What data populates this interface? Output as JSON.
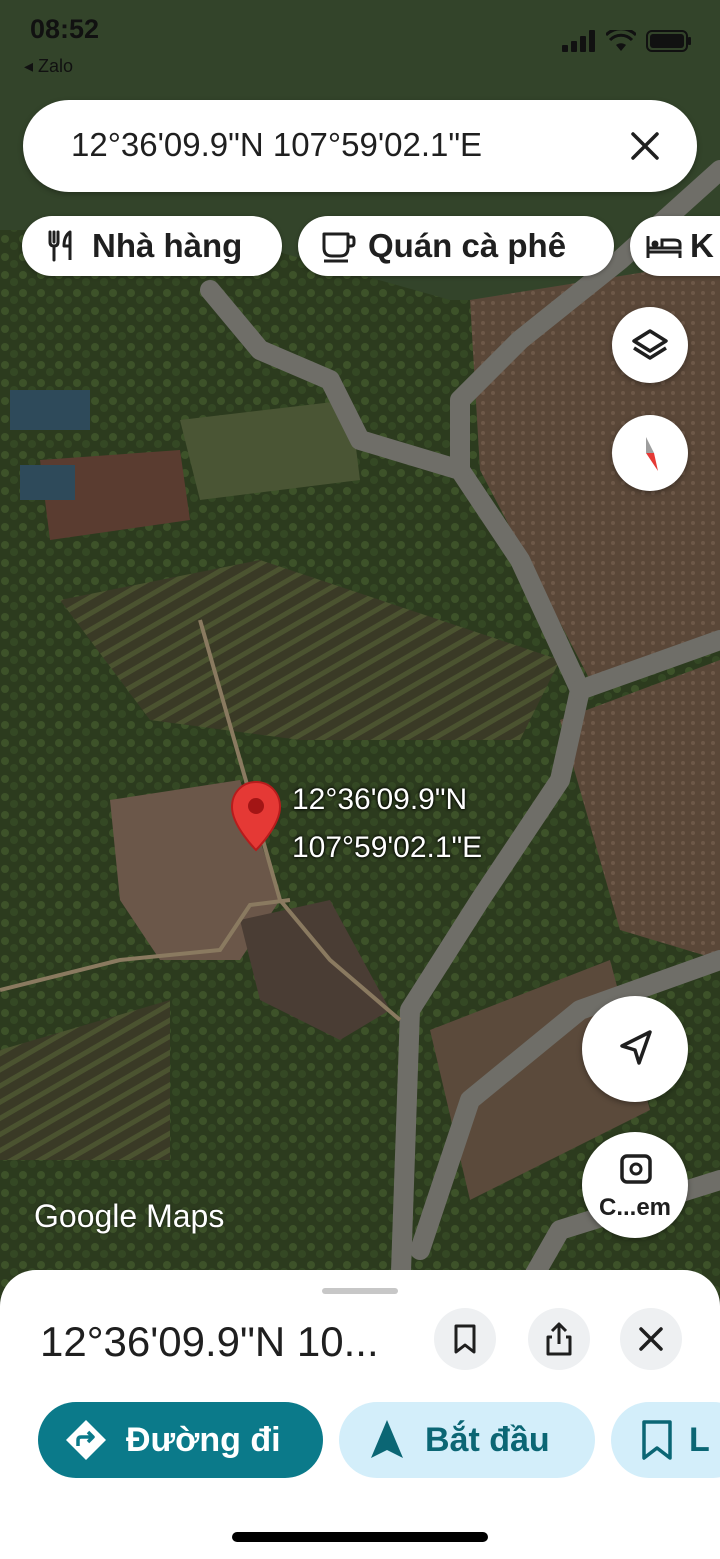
{
  "status_bar": {
    "time": "08:52",
    "back_app": "◂ Zalo"
  },
  "search": {
    "query": "12°36'09.9\"N 107°59'02.1\"E"
  },
  "chips": [
    {
      "label": "Nhà hàng",
      "icon": "fork-knife-icon"
    },
    {
      "label": "Quán cà phê",
      "icon": "coffee-cup-icon"
    },
    {
      "label": "K",
      "icon": "bed-icon"
    }
  ],
  "map": {
    "pin_label_line1": "12°36'09.9\"N",
    "pin_label_line2": "107°59'02.1\"E",
    "attribution": "Google Maps",
    "camera_button_label": "C...em"
  },
  "sheet": {
    "title": "12°36'09.9\"N 10...",
    "directions_label": "Đường đi",
    "start_label": "Bắt đầu",
    "save_label": "L"
  },
  "colors": {
    "accent": "#0b7a8a",
    "pill_light": "#d3eefa",
    "pin": "#e53935"
  }
}
